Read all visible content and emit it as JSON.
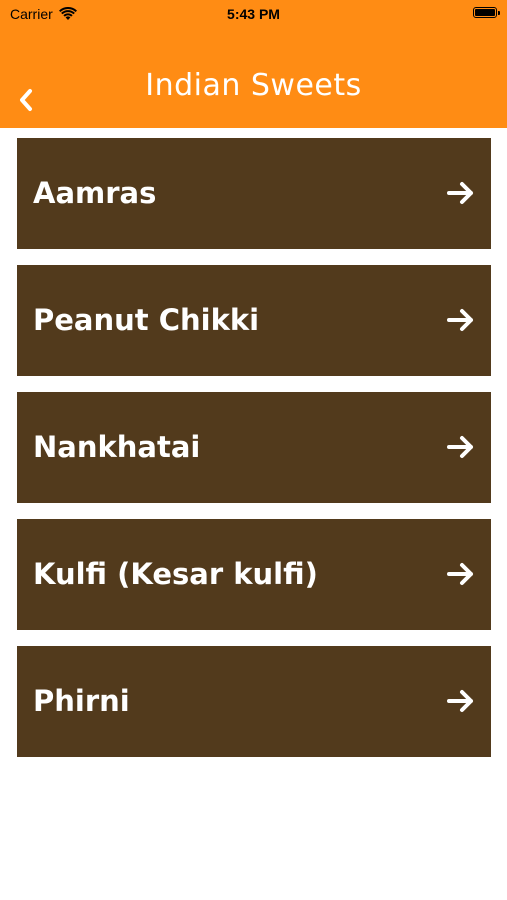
{
  "status_bar": {
    "carrier": "Carrier",
    "time": "5:43 PM",
    "wifi_icon": "wifi-icon",
    "battery_icon": "battery-icon"
  },
  "nav": {
    "title": "Indian Sweets",
    "back_icon": "chevron-left-icon",
    "background_color": "#ff8c14"
  },
  "items": [
    {
      "label": "Aamras",
      "icon": "arrow-right-icon"
    },
    {
      "label": "Peanut Chikki",
      "icon": "arrow-right-icon"
    },
    {
      "label": "Nankhatai",
      "icon": "arrow-right-icon"
    },
    {
      "label": "Kulfi (Kesar kulfi)",
      "icon": "arrow-right-icon"
    },
    {
      "label": "Phirni",
      "icon": "arrow-right-icon"
    }
  ],
  "colors": {
    "item_background": "#523a1c",
    "item_text": "#ffffff"
  }
}
